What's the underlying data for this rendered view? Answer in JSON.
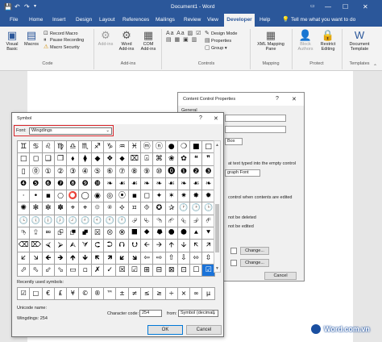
{
  "window": {
    "title": "Document1 - Word",
    "save_icon": "save-icon",
    "undo_icon": "undo-icon",
    "redo_icon": "redo-icon",
    "tell_me": "Tell me what you want to do"
  },
  "tabs": [
    "File",
    "Home",
    "Insert",
    "Design",
    "Layout",
    "References",
    "Mailings",
    "Review",
    "View",
    "Developer",
    "Help"
  ],
  "ribbon": {
    "code": {
      "visual_basic": "Visual Basic",
      "macros": "Macros",
      "record_macro": "Record Macro",
      "pause_recording": "Pause Recording",
      "macro_security": "Macro Security",
      "group": "Code"
    },
    "addins": {
      "addins": "Add-ins",
      "word_addins": "Word Add-ins",
      "com_addins": "COM Add-ins",
      "group": "Add-ins"
    },
    "controls": {
      "design_mode": "Design Mode",
      "properties": "Properties",
      "group_btn": "Group",
      "group": "Controls"
    },
    "mapping": {
      "xml_mapping_pane": "XML Mapping Pane",
      "group": "Mapping"
    },
    "protect": {
      "block_authors": "Block Authors",
      "restrict_editing": "Restrict Editing",
      "group": "Protect"
    },
    "templates": {
      "document_template": "Document Template",
      "group": "Templates"
    }
  },
  "content_control": {
    "title": "Content Control Properties",
    "help": "?",
    "close": "✕",
    "general": "General",
    "box": "Box",
    "text_typed": "at text typed into the empty control",
    "paragraph_font": "graph Font",
    "when_edited": "control when contents are edited",
    "not_deleted": "not be deleted",
    "not_edited": "not be edited",
    "change1": "Change...",
    "change2": "Change...",
    "cancel": "Cancel"
  },
  "symbol_dialog": {
    "title": "Symbol",
    "help": "?",
    "close": "✕",
    "font_label": "Font:",
    "font_value": "Wingdings",
    "rows": [
      [
        "♊",
        "♋",
        "♌",
        "♍",
        "♎",
        "♏",
        "♐",
        "♑",
        "♒",
        "♓",
        "ⓜ",
        "ⓝ",
        "●",
        "❍",
        "■",
        "□"
      ],
      [
        "□",
        "◻",
        "❑",
        "❒",
        "⬧",
        "⧫",
        "◆",
        "❖",
        "⬥",
        "⌧",
        "⍓",
        "⌘",
        "❀",
        "✿",
        "❝",
        "❞"
      ],
      [
        "▯",
        "⓪",
        "①",
        "②",
        "③",
        "④",
        "⑤",
        "⑥",
        "⑦",
        "⑧",
        "⑨",
        "⑩",
        "⓿",
        "❶",
        "❷",
        "❸"
      ],
      [
        "❹",
        "❺",
        "❻",
        "❼",
        "❽",
        "❾",
        "❿",
        "❧",
        "☙",
        "☙",
        "❧",
        "❧",
        "☙",
        "❧",
        "☙",
        "❧"
      ],
      [
        "·",
        "•",
        "▪",
        "○",
        "⭕",
        "◯",
        "◉",
        "◎",
        "⦿",
        "▪",
        "◻",
        "✦",
        "✶",
        "✷",
        "✸",
        "✹"
      ],
      [
        "✺",
        "✻",
        "✼",
        "✽",
        "⌖",
        "⌖",
        "⯐",
        "⍟",
        "⯎",
        "⯏",
        "⯑",
        "✪",
        "✰",
        "🕐",
        "🕑",
        "🕒"
      ],
      [
        "🕓",
        "🕔",
        "🕕",
        "🕖",
        "🕗",
        "🕘",
        "🕙",
        "🕚",
        "🕛",
        "⮰",
        "⮱",
        "⮲",
        "⮳",
        "⮴",
        "⮵",
        "⮶"
      ],
      [
        "⮷",
        "⮸",
        "⮹",
        "⮺",
        "⮻",
        "⮼",
        "⮽",
        "⮾",
        "⮿",
        "⯀",
        "⯁",
        "⯂",
        "⯃",
        "⯄",
        "⯅",
        "⯆"
      ],
      [
        "⌫",
        "⌦",
        "⮘",
        "⮚",
        "⮙",
        "⮛",
        "⮈",
        "⮊",
        "⮉",
        "⮋",
        "🡨",
        "🡪",
        "🡩",
        "🡫",
        "🡬",
        "🡭"
      ],
      [
        "🡯",
        "🡮",
        "🡸",
        "🡺",
        "🡹",
        "🡻",
        "🡼",
        "🡽",
        "🡿",
        "🡾",
        "⇦",
        "⇨",
        "⇧",
        "⇩",
        "⬄",
        "⇳"
      ],
      [
        "⬀",
        "⬁",
        "⬃",
        "⬂",
        "▭",
        "▫",
        "✗",
        "✓",
        "☒",
        "☑",
        "⊞",
        "⊟",
        "⊠",
        "⊡",
        "☐",
        "☑"
      ]
    ],
    "selected_cell": "☑",
    "recently_used_label": "Recently used symbols:",
    "recent": [
      "☑",
      "□",
      "€",
      "£",
      "¥",
      "©",
      "®",
      "™",
      "±",
      "≠",
      "≤",
      "≥",
      "÷",
      "×",
      "∞",
      "µ"
    ],
    "unicode_name_label": "Unicode name:",
    "unicode_name": "Wingdings: 254",
    "char_code_label": "Character code:",
    "char_code": "254",
    "from_label": "from:",
    "from_value": "Symbol (decimal)",
    "ok": "OK",
    "cancel": "Cancel"
  },
  "watermark": "Word.com.vn",
  "colors": {
    "title_blue": "#2b579a",
    "selected": "#1a73d9",
    "highlight": "#d9252b"
  }
}
